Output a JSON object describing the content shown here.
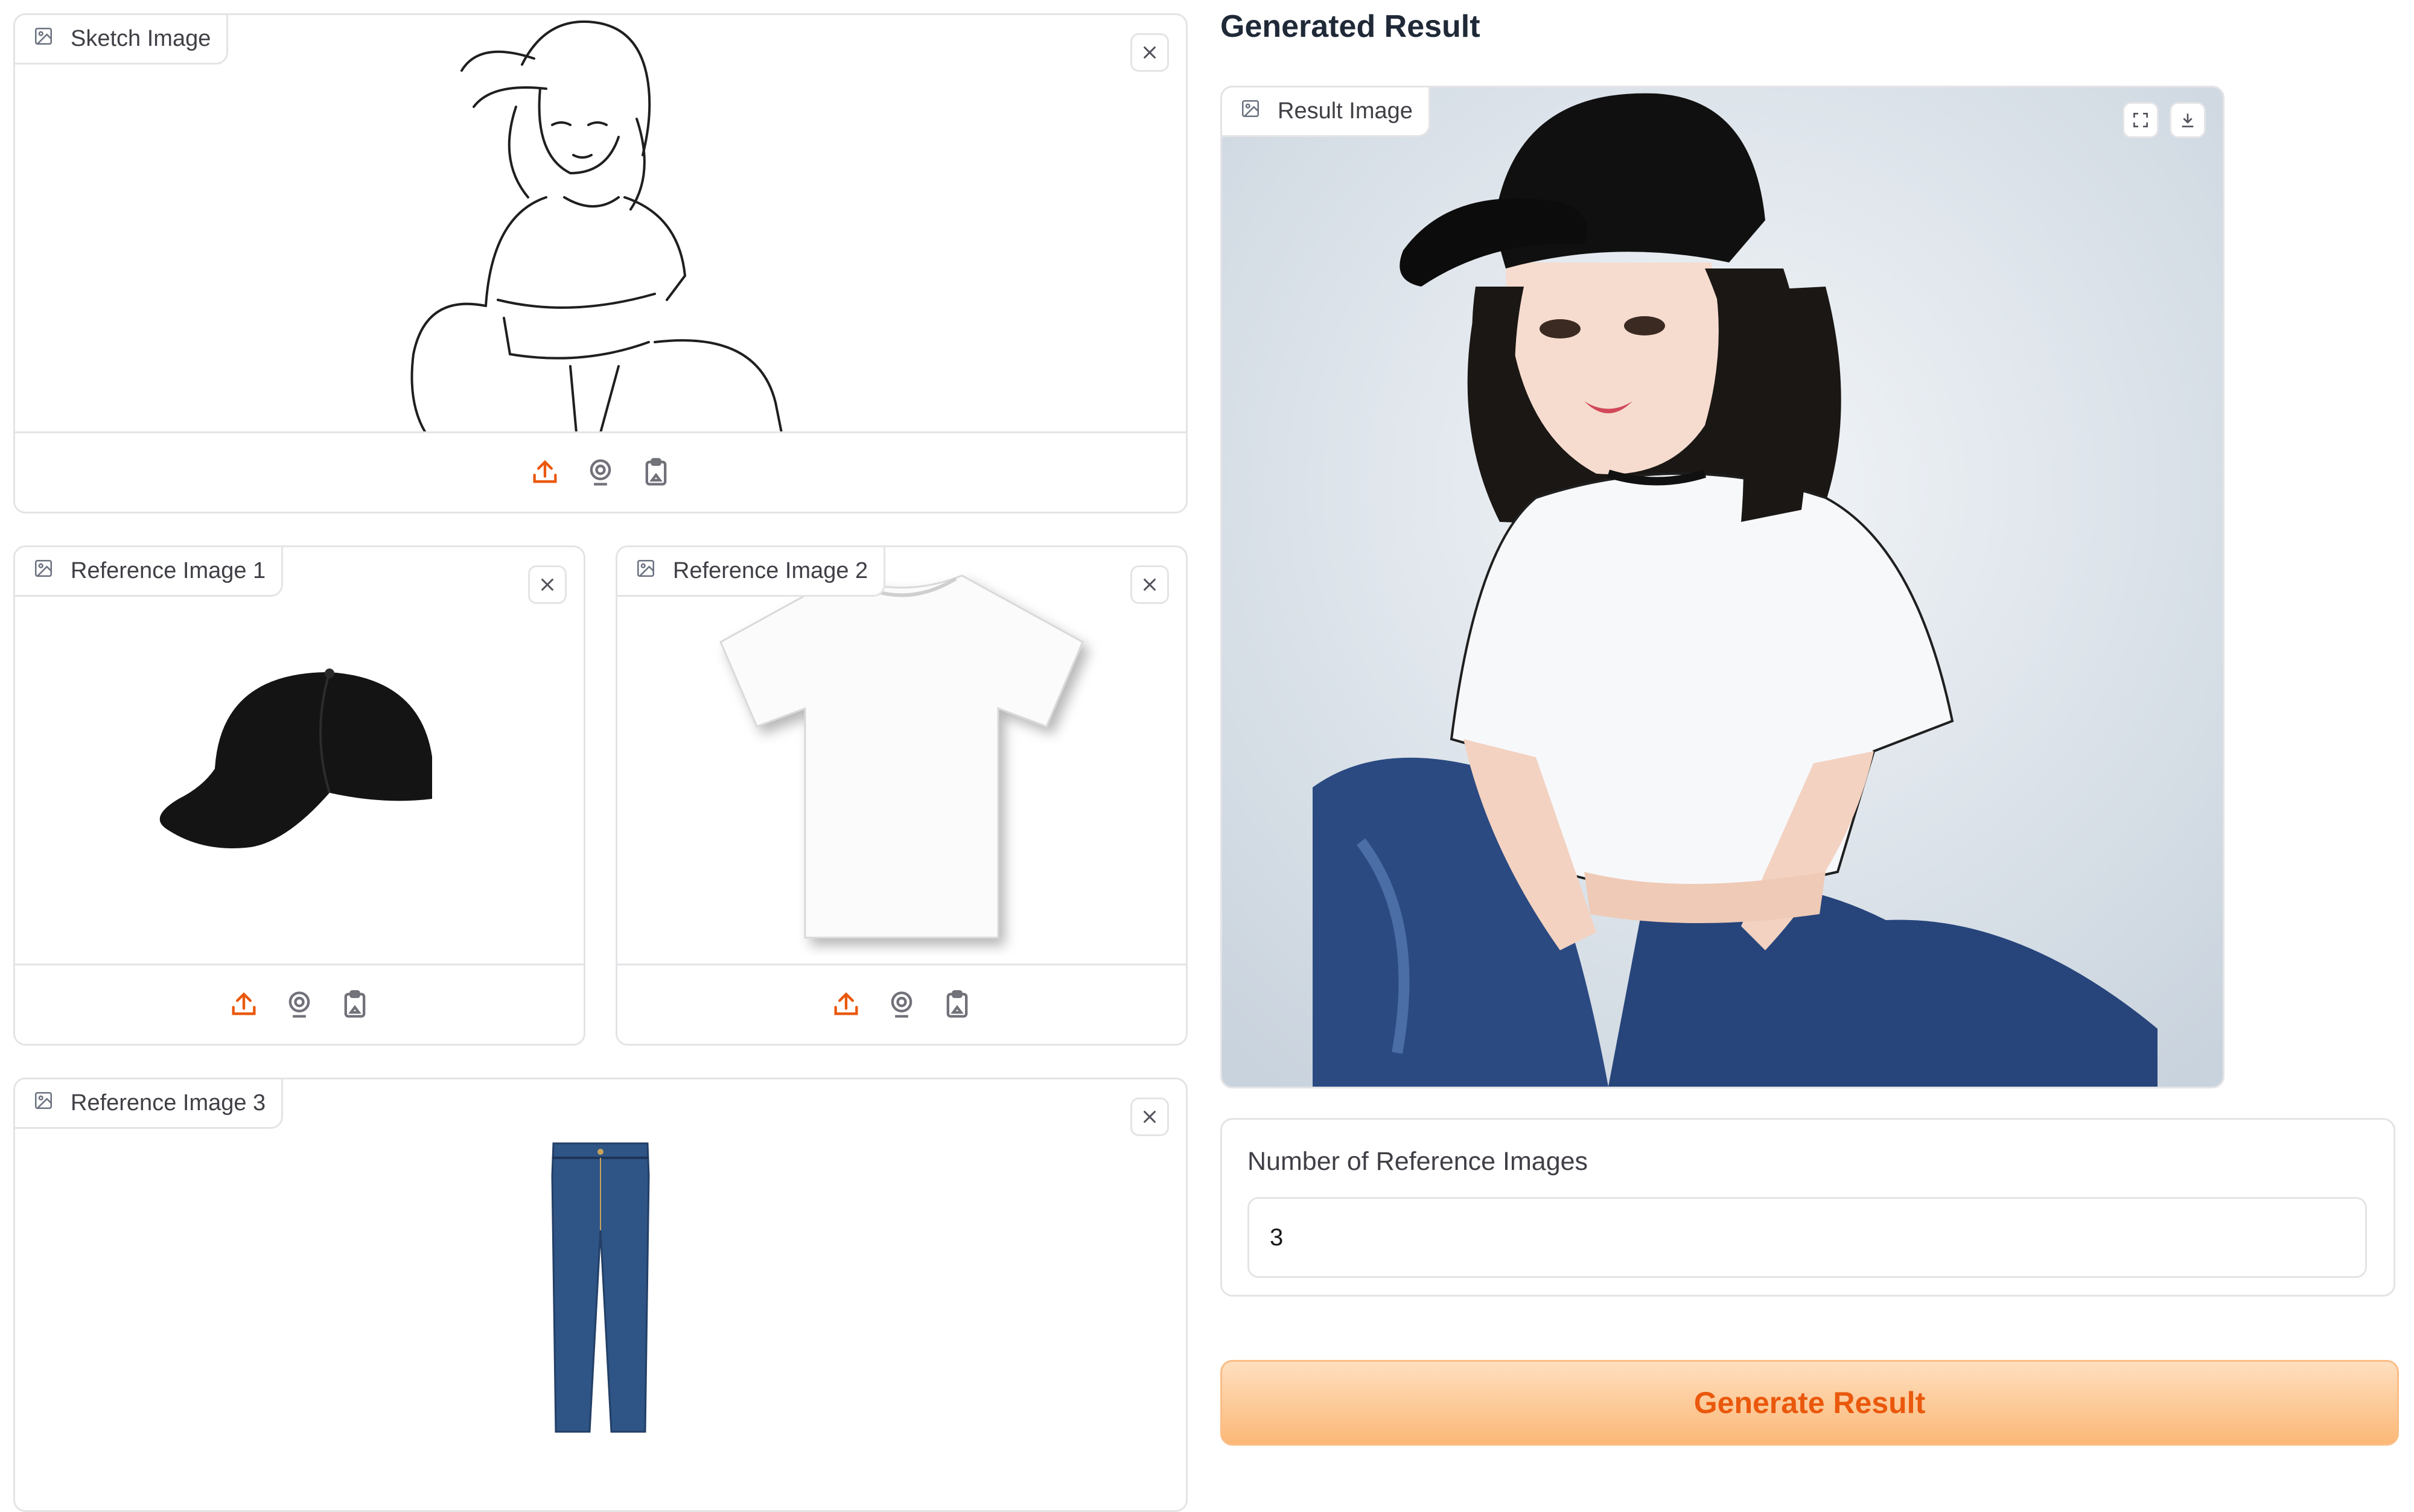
{
  "sketch_panel": {
    "label": "Sketch Image",
    "icon": "image-icon"
  },
  "reference_panels": [
    {
      "label": "Reference Image 1",
      "subject": "black baseball cap"
    },
    {
      "label": "Reference Image 2",
      "subject": "white t-shirt"
    },
    {
      "label": "Reference Image 3",
      "subject": "blue denim jeans"
    }
  ],
  "upload_toolbar": {
    "icons": [
      "upload-icon",
      "webcam-icon",
      "clipboard-paste-icon"
    ]
  },
  "result": {
    "section_title": "Generated Result",
    "panel_label": "Result Image",
    "actions": [
      "fullscreen-icon",
      "download-icon"
    ]
  },
  "reference_count": {
    "label": "Number of Reference Images",
    "value": "3"
  },
  "generate_button": {
    "label": "Generate Result"
  },
  "colors": {
    "accent_orange": "#ea580c",
    "button_gradient_top": "#fedfbf",
    "button_gradient_bottom": "#fbb877",
    "border": "#e4e4e7"
  }
}
